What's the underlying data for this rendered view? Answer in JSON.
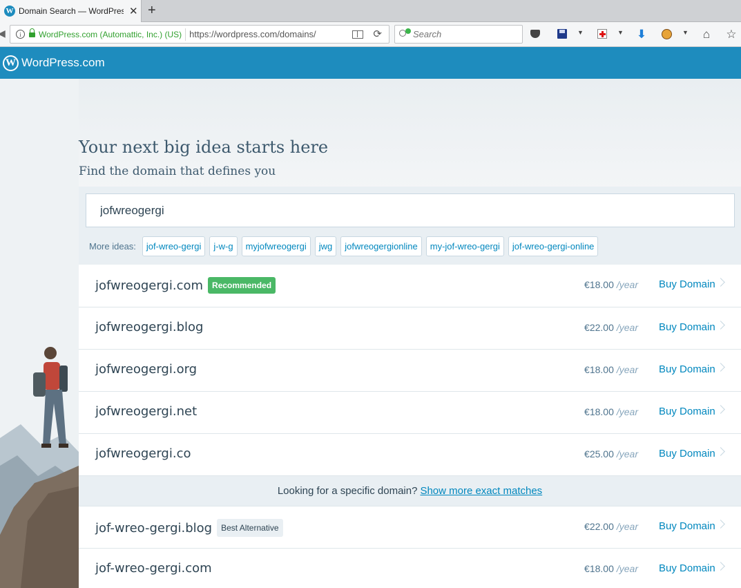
{
  "browser": {
    "tab_title": "Domain Search — WordPres",
    "identity": "WordPress.com (Automattic, Inc.) (US)",
    "url": "https://wordpress.com/domains/",
    "search_placeholder": "Search"
  },
  "masterbar": {
    "brand": "WordPress.com"
  },
  "hero": {
    "heading": "Your next big idea starts here",
    "subheading": "Find the domain that defines you"
  },
  "search": {
    "query": "jofwreogergi",
    "more_ideas_label": "More ideas:",
    "ideas": [
      "jof-wreo-gergi",
      "j-w-g",
      "myjofwreogergi",
      "jwg",
      "jofwreogergionline",
      "my-jof-wreo-gergi",
      "jof-wreo-gergi-online"
    ]
  },
  "results": [
    {
      "domain": "jofwreogergi.com",
      "badge": "Recommended",
      "price": "€18.00",
      "per": "/year",
      "action": "Buy Domain"
    },
    {
      "domain": "jofwreogergi.blog",
      "price": "€22.00",
      "per": "/year",
      "action": "Buy Domain"
    },
    {
      "domain": "jofwreogergi.org",
      "price": "€18.00",
      "per": "/year",
      "action": "Buy Domain"
    },
    {
      "domain": "jofwreogergi.net",
      "price": "€18.00",
      "per": "/year",
      "action": "Buy Domain"
    },
    {
      "domain": "jofwreogergi.co",
      "price": "€25.00",
      "per": "/year",
      "action": "Buy Domain"
    }
  ],
  "exact_matches": {
    "prompt": "Looking for a specific domain?",
    "link": "Show more exact matches"
  },
  "alternatives": [
    {
      "domain": "jof-wreo-gergi.blog",
      "badge": "Best Alternative",
      "price": "€22.00",
      "per": "/year",
      "action": "Buy Domain"
    },
    {
      "domain": "jof-wreo-gergi.com",
      "price": "€18.00",
      "per": "/year",
      "action": "Buy Domain"
    }
  ],
  "colors": {
    "masterbar": "#1e8cbe",
    "link": "#0087be",
    "recommended_badge": "#4ab866",
    "text": "#2e4453"
  }
}
